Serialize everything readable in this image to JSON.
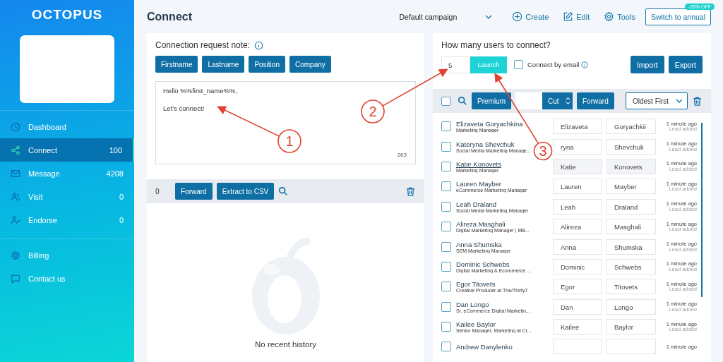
{
  "brand": "OCTOPUS",
  "sidebar": {
    "items": [
      {
        "label": "Dashboard",
        "selected": false
      },
      {
        "label": "Connect",
        "count": "100",
        "selected": true
      },
      {
        "label": "Message",
        "count": "4208",
        "selected": false
      },
      {
        "label": "Visit",
        "count": "0",
        "selected": false
      },
      {
        "label": "Endorse",
        "count": "0",
        "selected": false
      }
    ],
    "footer_items": [
      {
        "label": "Billing",
        "selected": false
      },
      {
        "label": "Contact us",
        "selected": false
      }
    ]
  },
  "header": {
    "title": "Connect",
    "campaign": "Default campaign",
    "actions": [
      "Create",
      "Edit",
      "Tools"
    ],
    "upgrade": {
      "label": "Switch to annual",
      "badge": "-35% OFF"
    }
  },
  "note": {
    "label": "Connection request note:",
    "chips": [
      "Firstname",
      "Lastname",
      "Position",
      "Company"
    ],
    "paragraphs": [
      "Hello %%first_name%%,",
      "Let's connect!"
    ],
    "counter": "263"
  },
  "history": {
    "count": "0",
    "buttons": [
      "Forward",
      "Extract to CSV"
    ],
    "empty": "No recent history"
  },
  "launch": {
    "question": "How many users to connect?",
    "amount": "5",
    "button": "Launch",
    "email_label": "Connect by email",
    "email_checked": false,
    "buttons": [
      "Import",
      "Export"
    ]
  },
  "list_toolbar": {
    "checked": false,
    "premium": "Premium",
    "cut": "Cut",
    "forward": "Forward",
    "sort": "Oldest First"
  },
  "leads": [
    {
      "name": "Elizaveta Goryachkina",
      "title": "Marketing Manager",
      "first": "Elizaveta",
      "last": "Goryachkii",
      "time": "1 minute ago",
      "status": "Lead added",
      "checked": false,
      "selected": false
    },
    {
      "name": "Kateryna Shevchuk",
      "title": "Social Media Marketing Manage...",
      "first": "ryna",
      "last": "Shevchuk",
      "time": "1 minute ago",
      "status": "Lead added",
      "checked": false,
      "selected": false
    },
    {
      "name": "Katie Konovets",
      "title": "Marketing Manager",
      "first": "Katie",
      "last": "Konovets",
      "time": "1 minute ago",
      "status": "Lead added",
      "checked": false,
      "selected": true
    },
    {
      "name": "Lauren Mayber",
      "title": "eCommerce Marketing Manager",
      "first": "Lauren",
      "last": "Mayber",
      "time": "1 minute ago",
      "status": "Lead added",
      "checked": false,
      "selected": false
    },
    {
      "name": "Leah Draland",
      "title": "Social Media Marketing Manager",
      "first": "Leah",
      "last": "Draland",
      "time": "1 minute ago",
      "status": "Lead added",
      "checked": false,
      "selected": false
    },
    {
      "name": "Alireza Masghali",
      "title": "Digital Marketing Manager | MB...",
      "first": "Alireza",
      "last": "Masghali",
      "time": "1 minute ago",
      "status": "Lead added",
      "checked": false,
      "selected": false
    },
    {
      "name": "Anna Shumska",
      "title": "SEM Marketing Manager",
      "first": "Anna",
      "last": "Shumska",
      "time": "1 minute ago",
      "status": "Lead added",
      "checked": false,
      "selected": false
    },
    {
      "name": "Dominic Schwebs",
      "title": "Digital Marketing & Ecommerce ...",
      "first": "Dominic",
      "last": "Schwebs",
      "time": "1 minute ago",
      "status": "Lead added",
      "checked": false,
      "selected": false
    },
    {
      "name": "Egor Titovets",
      "title": "Creative Producer at The/Thirty7",
      "first": "Egor",
      "last": "Titovets",
      "time": "1 minute ago",
      "status": "Lead added",
      "checked": false,
      "selected": false
    },
    {
      "name": "Dan Longo",
      "title": "Sr. eCommerce Digital Marketin...",
      "first": "Dan",
      "last": "Longo",
      "time": "1 minute ago",
      "status": "Lead added",
      "checked": false,
      "selected": false
    },
    {
      "name": "Kailee Baylor",
      "title": "Senior Manager, Marketing at Cr...",
      "first": "Kailee",
      "last": "Baylor",
      "time": "1 minute ago",
      "status": "Lead added",
      "checked": false,
      "selected": false
    },
    {
      "name": "Andrew Danylenko",
      "time": "1 minute ago",
      "checked": false,
      "selected": false
    }
  ],
  "annotations": [
    "1",
    "2",
    "3"
  ]
}
